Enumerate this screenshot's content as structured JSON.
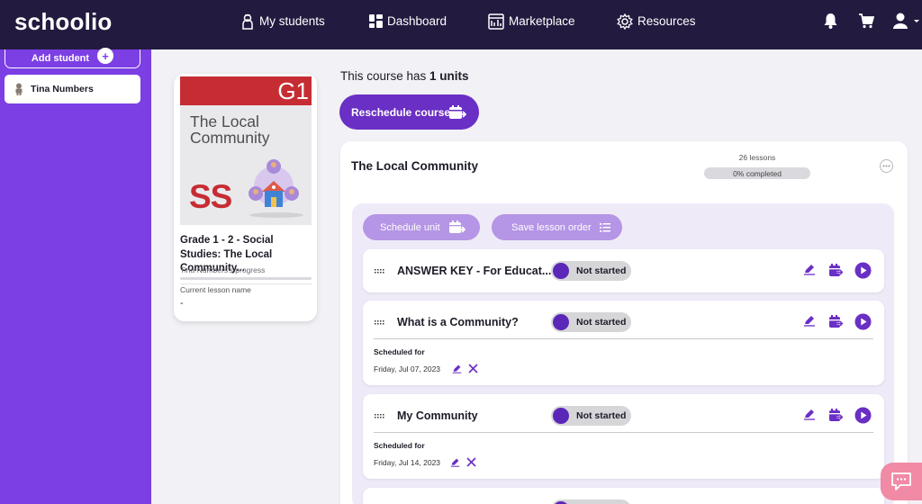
{
  "topbar": {
    "logo": "schoolio",
    "nav": {
      "students": "My students",
      "dashboard": "Dashboard",
      "marketplace": "Marketplace",
      "resources": "Resources"
    }
  },
  "sidebar": {
    "add_student": "Add student",
    "add_plus": "+",
    "students": [
      {
        "name": "Tina Numbers"
      }
    ]
  },
  "course": {
    "cover": {
      "grade": "G1",
      "title": "The Local Community",
      "subject_code": "SS"
    },
    "title": "Grade 1 - 2 - Social Studies: The Local Community...",
    "progress_label": "Tina Numbers's progress",
    "progress": 0,
    "current_lesson_label": "Current lesson name",
    "current_lesson_value": "-"
  },
  "main": {
    "units_prefix": "This course has ",
    "units_count": "1 units",
    "reschedule_label": "Reschedule course"
  },
  "unit": {
    "title": "The Local Community",
    "lessons_count": "26 lessons",
    "progress_text": "0% completed",
    "progress": 0,
    "schedule_unit": "Schedule unit",
    "save_order": "Save lesson order"
  },
  "lessons": [
    {
      "name": "ANSWER KEY - For Educat...",
      "status": "Not started"
    },
    {
      "name": "What is a Community?",
      "status": "Not started",
      "scheduled_label": "Scheduled for",
      "scheduled_date": "Friday, Jul 07, 2023"
    },
    {
      "name": "My Community",
      "status": "Not started",
      "scheduled_label": "Scheduled for",
      "scheduled_date": "Friday, Jul 14, 2023"
    }
  ],
  "colors": {
    "topbar": "#221a3f",
    "sidebar": "#7c3fe4",
    "primary": "#6a2fc4",
    "pill": "#b595e5",
    "status_dot": "#5b27b8",
    "chat": "#f08aa5"
  },
  "icons": [
    "students-icon",
    "dashboard-icon",
    "marketplace-icon",
    "resources-icon",
    "bell-icon",
    "cart-icon",
    "user-icon",
    "edit-icon",
    "calendar-icon",
    "play-icon",
    "drag-icon",
    "close-icon",
    "chat-icon",
    "list-icon"
  ]
}
